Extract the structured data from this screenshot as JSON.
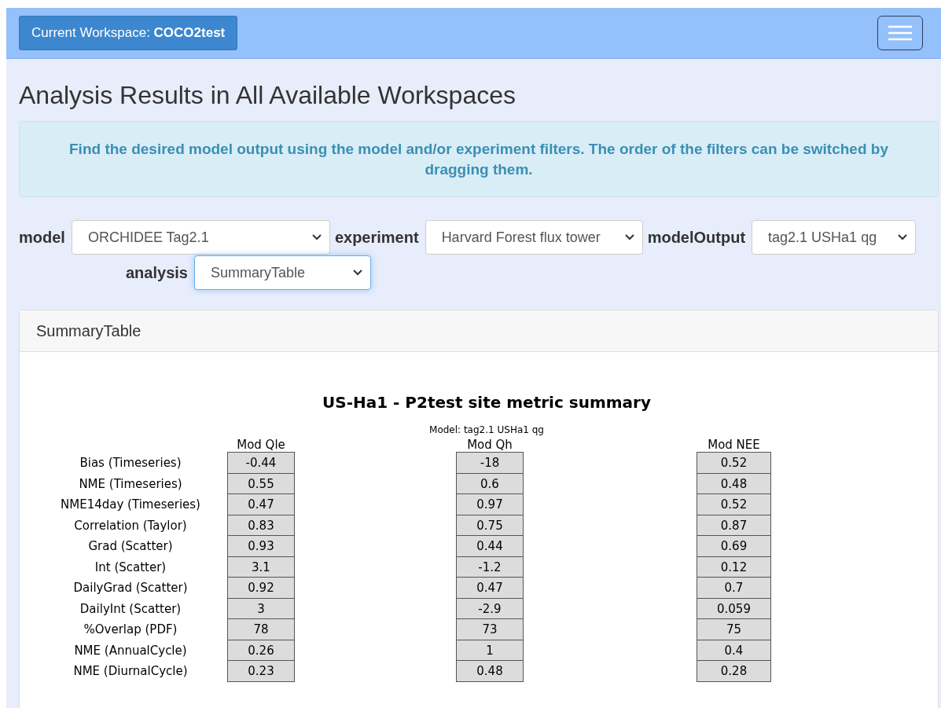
{
  "navbar": {
    "workspace_button": "Current Workspace: **COCO2test**"
  },
  "page_title": "Analysis Results in All Available Workspaces",
  "info_alert": "Find the desired model output using the model and/or experiment filters. The order of the filters can be switched by dragging them.",
  "filters": [
    {
      "label": "model",
      "value": "ORCHIDEE Tag2.1",
      "focused": false
    },
    {
      "label": "experiment",
      "value": "Harvard Forest flux tower",
      "focused": false
    },
    {
      "label": "modelOutput",
      "value": "tag2.1 USHa1 qg",
      "focused": false
    },
    {
      "label": "analysis",
      "value": "SummaryTable",
      "focused": true
    }
  ],
  "result_card": {
    "header": "SummaryTable",
    "summary": {
      "title": "US-Ha1 - P2test site metric summary",
      "subtitle": "Model: tag2.1 USHa1 qg",
      "row_labels": [
        "Bias (Timeseries)",
        "NME (Timeseries)",
        "NME14day (Timeseries)",
        "Correlation (Taylor)",
        "Grad (Scatter)",
        "Int (Scatter)",
        "DailyGrad (Scatter)",
        "DailyInt (Scatter)",
        "%Overlap (PDF)",
        "NME (AnnualCycle)",
        "NME (DiurnalCycle)"
      ],
      "columns": [
        {
          "header": "Mod Qle",
          "values": [
            "-0.44",
            "0.55",
            "0.47",
            "0.83",
            "0.93",
            "3.1",
            "0.92",
            "3",
            "78",
            "0.26",
            "0.23"
          ]
        },
        {
          "header": "Mod Qh",
          "values": [
            "-18",
            "0.6",
            "0.97",
            "0.75",
            "0.44",
            "-1.2",
            "0.47",
            "-2.9",
            "73",
            "1",
            "0.48"
          ]
        },
        {
          "header": "Mod NEE",
          "values": [
            "0.52",
            "0.48",
            "0.52",
            "0.87",
            "0.69",
            "0.12",
            "0.7",
            "0.059",
            "75",
            "0.4",
            "0.28"
          ]
        }
      ]
    }
  }
}
